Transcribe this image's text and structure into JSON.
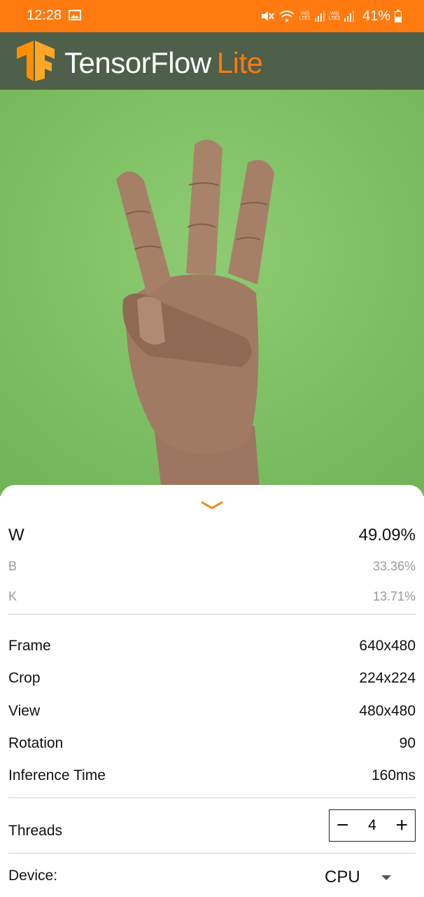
{
  "status_bar": {
    "time": "12:28",
    "battery": "41%",
    "sim1": "LTE1",
    "sim2": "LTE2",
    "volte": "Vo))"
  },
  "app_bar": {
    "title_main": "TensorFlow",
    "title_accent": "Lite",
    "accent_color": "#FF7A0F",
    "bar_color": "#4E5F4A"
  },
  "results": [
    {
      "label": "W",
      "value": "49.09%"
    },
    {
      "label": "B",
      "value": "33.36%"
    },
    {
      "label": "K",
      "value": "13.71%"
    }
  ],
  "info": [
    {
      "label": "Frame",
      "value": "640x480"
    },
    {
      "label": "Crop",
      "value": "224x224"
    },
    {
      "label": "View",
      "value": "480x480"
    },
    {
      "label": "Rotation",
      "value": "90"
    },
    {
      "label": "Inference Time",
      "value": "160ms"
    }
  ],
  "threads": {
    "label": "Threads",
    "value": "4",
    "minus": "−",
    "plus": "+"
  },
  "device": {
    "label": "Device:",
    "selected": "CPU"
  }
}
